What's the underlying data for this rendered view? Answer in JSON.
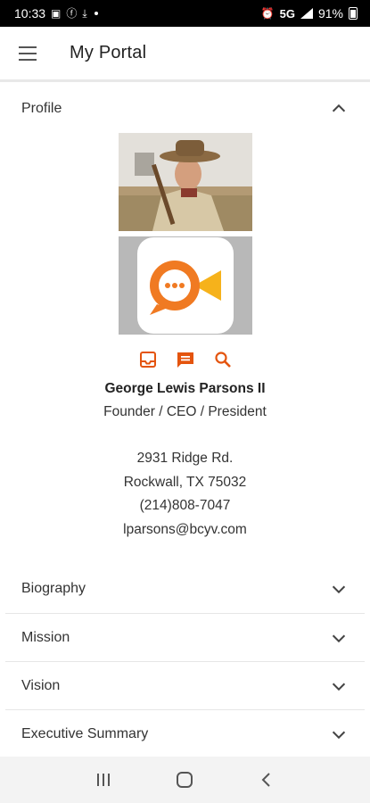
{
  "status_bar": {
    "time": "10:33",
    "network": "5G",
    "battery": "91%"
  },
  "app_bar": {
    "title": "My Portal"
  },
  "sections": {
    "profile": {
      "label": "Profile",
      "expanded": true
    },
    "biography": {
      "label": "Biography",
      "expanded": false
    },
    "mission": {
      "label": "Mission",
      "expanded": false
    },
    "vision": {
      "label": "Vision",
      "expanded": false
    },
    "executive_summary": {
      "label": "Executive Summary",
      "expanded": false
    }
  },
  "profile": {
    "name": "George Lewis Parsons II",
    "role": "Founder / CEO / President",
    "address_line1": "2931 Ridge Rd.",
    "address_line2": "Rockwall, TX 75032",
    "phone": "(214)808-7047",
    "email": "lparsons@bcyv.com"
  },
  "colors": {
    "accent": "#e4540e",
    "logo_orange": "#f07a22",
    "logo_yellow": "#f6b21b"
  },
  "icons": {
    "menu": "menu-icon",
    "collapse": "chevron-up-icon",
    "expand": "chevron-down-icon",
    "inbox": "inbox-icon",
    "message": "message-icon",
    "search": "search-icon"
  }
}
